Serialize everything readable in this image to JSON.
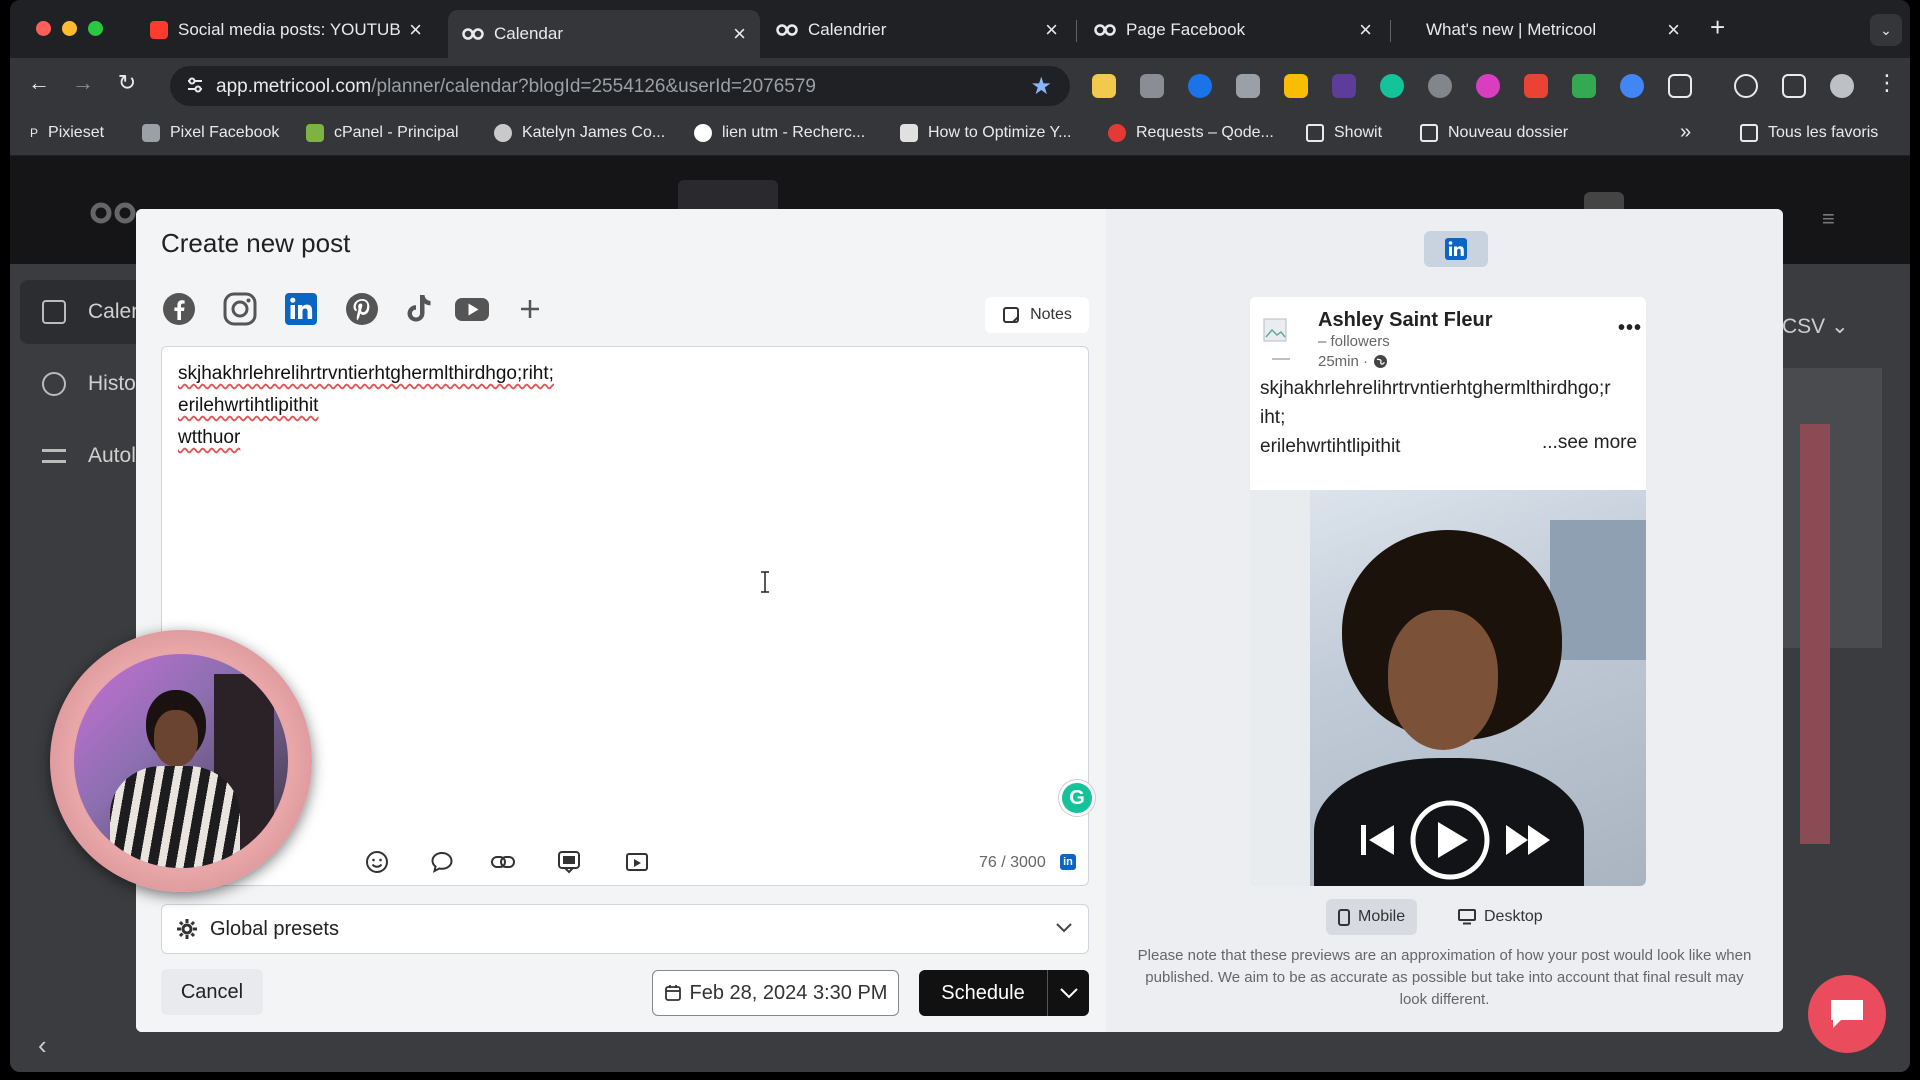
{
  "browser": {
    "tabs": [
      {
        "label": "Social media posts: YOUTUBE",
        "active": false
      },
      {
        "label": "Calendar",
        "active": true
      },
      {
        "label": "Calendrier",
        "active": false
      },
      {
        "label": "Page Facebook",
        "active": false
      },
      {
        "label": "What's new | Metricool",
        "active": false
      }
    ],
    "url_host": "app.metricool.com",
    "url_path": "/planner/calendar?blogId=2554126&userId=2076579",
    "bookmarks": [
      "Pixieset",
      "Pixel Facebook",
      "cPanel - Principal",
      "Katelyn James Co...",
      "lien utm - Recherc...",
      "How to Optimize Y...",
      "Requests – Qode...",
      "Showit",
      "Nouveau dossier"
    ],
    "bookmarks_overflow": "»",
    "all_bookmarks": "Tous les favoris"
  },
  "app": {
    "sidebar": [
      "Calen",
      "Histor",
      "Autol"
    ],
    "csv": "CSV"
  },
  "modal": {
    "title": "Create new post",
    "networks": [
      "facebook-icon",
      "instagram-icon",
      "linkedin-icon",
      "pinterest-icon",
      "tiktok-icon",
      "youtube-icon",
      "plus-icon"
    ],
    "notes_label": "Notes",
    "editor_lines": [
      "skjhakhrlehrelihrtrvntierhtghermlthirdhgo;riht;",
      "erilehwrtihtlipithit",
      "wtthuor"
    ],
    "char_count": "76 / 3000",
    "presets_label": "Global presets",
    "cancel_label": "Cancel",
    "date_label": "Feb 28, 2024 3:30 PM",
    "schedule_label": "Schedule"
  },
  "preview": {
    "network": "linkedin",
    "author": "Ashley Saint Fleur",
    "followers": "– followers",
    "time": "25min ·",
    "text_lines": [
      "skjhakhrlehrelihrtrvntierhtghermlthirdhgo;r",
      "iht;",
      "erilehwrtihtlipithit"
    ],
    "see_more": "...see more",
    "mobile_label": "Mobile",
    "desktop_label": "Desktop",
    "disclaimer": "Please note that these previews are an approximation of how your post would look like when published. We aim to be as accurate as possible but take into account that final result may look different."
  },
  "colors": {
    "linkedin": "#0a66c2",
    "facebook": "#1877f2",
    "grammarly": "#15c39a",
    "chat": "#ea4c5d"
  }
}
